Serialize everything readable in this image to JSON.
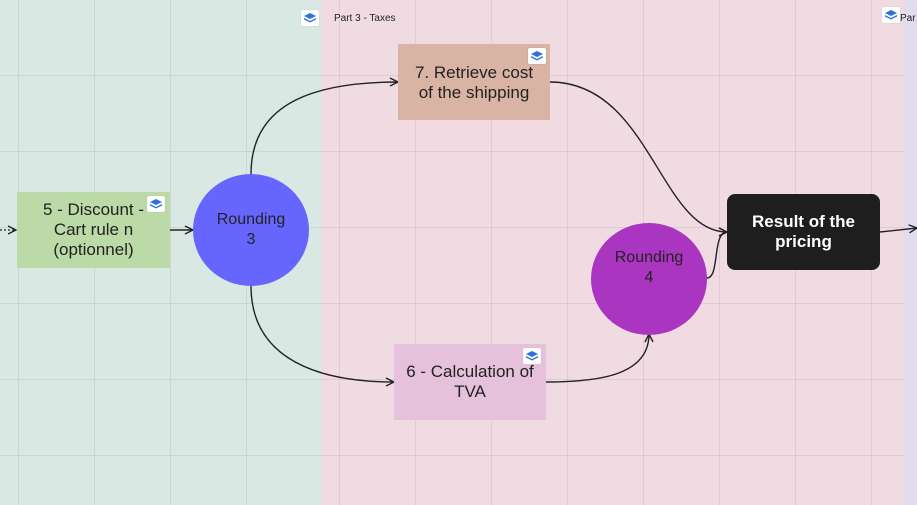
{
  "zones": {
    "taxes_label": "Part 3 - Taxes",
    "next_label": "Par"
  },
  "nodes": {
    "discount": "5 - Discount -\nCart rule n\n(optionnel)",
    "rounding3": "Rounding\n3",
    "retrieve_shipping": "7. Retrieve cost\nof the shipping",
    "calc_tva": "6 - Calculation of\nTVA",
    "rounding4": "Rounding\n4",
    "result": "Result of the\npricing"
  },
  "colors": {
    "discount": "#bcdaa8",
    "rounding3": "#6666ff",
    "retrieve_shipping": "#d9b3a3",
    "calc_tva": "#e6c1db",
    "rounding4": "#aa35c0",
    "result": "#1e1e1e"
  },
  "icons": [
    "cube-icon"
  ]
}
